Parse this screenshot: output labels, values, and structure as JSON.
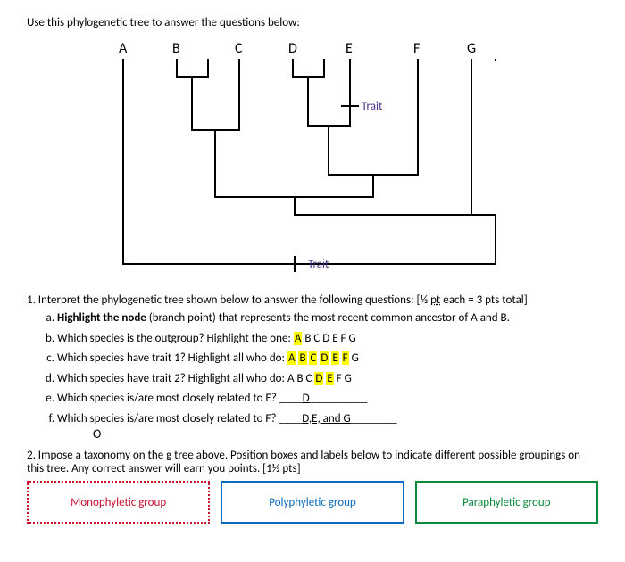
{
  "prompt": "Use this phylogenetic tree to answer the questions below:",
  "tree": {
    "taxa": [
      "A",
      "B",
      "C",
      "D",
      "E",
      "F",
      "G"
    ],
    "trait_upper": "Trait",
    "trait_lower": "Trait"
  },
  "q1": {
    "stem": "1. Interpret the phylogenetic tree shown below to answer the following questions: [½ ",
    "stem_pt": "pt",
    "stem_tail": " each = 3 pts total]",
    "a_pre": "Highlight the node",
    "a_rest": " (branch point) that represents the most recent common ancestor of A and B.",
    "b": "Which species is the outgroup? Highlight the one: ",
    "b_taxa": [
      {
        "t": "A",
        "hl": true
      },
      {
        "t": "B",
        "hl": false
      },
      {
        "t": "C",
        "hl": false
      },
      {
        "t": "D",
        "hl": false
      },
      {
        "t": "E",
        "hl": false
      },
      {
        "t": "F",
        "hl": false
      },
      {
        "t": "G",
        "hl": false
      }
    ],
    "c": "Which species have trait 1?  Highlight all who do: ",
    "c_taxa": [
      {
        "t": "A",
        "hl": true
      },
      {
        "t": "B",
        "hl": true
      },
      {
        "t": "C",
        "hl": true
      },
      {
        "t": "D",
        "hl": true
      },
      {
        "t": "E",
        "hl": true
      },
      {
        "t": "F",
        "hl": true
      },
      {
        "t": "G",
        "hl": false
      }
    ],
    "d": "Which species have trait 2?  Highlight all who do: ",
    "d_taxa": [
      {
        "t": "A",
        "hl": false
      },
      {
        "t": "B",
        "hl": false
      },
      {
        "t": "C",
        "hl": false
      },
      {
        "t": "D",
        "hl": true
      },
      {
        "t": "E",
        "hl": true
      },
      {
        "t": "F",
        "hl": false
      },
      {
        "t": "G",
        "hl": false
      }
    ],
    "e": "Which species is/are most closely related to E? ____",
    "e_ans": "D",
    "e_tail": "__________",
    "f": "Which species is/are most closely related to F? ____",
    "f_ans": "D,E, and G",
    "f_tail": "________"
  },
  "q2": {
    "stem": "2. Impose a taxonomy on the g tree above.  Position boxes and labels below to indicate different possible groupings on this tree.  Any correct answer will earn you points. [1½ pts]",
    "mono": "Monophyletic group",
    "poly": "Polyphyletic group",
    "para": "Paraphyletic group"
  }
}
